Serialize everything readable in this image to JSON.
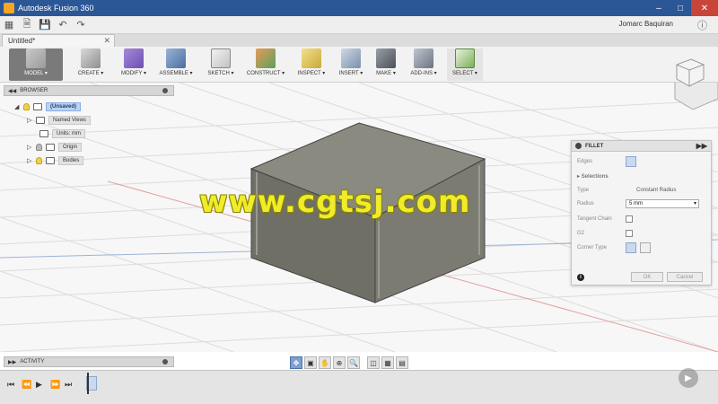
{
  "window": {
    "title": "Autodesk Fusion 360"
  },
  "quickbar": {
    "user": "Jomarc Baquiran"
  },
  "tab": {
    "name": "Untitled*"
  },
  "toolbar": {
    "items": [
      {
        "label": "MODEL ▾"
      },
      {
        "label": "CREATE ▾"
      },
      {
        "label": "MODIFY ▾"
      },
      {
        "label": "ASSEMBLE ▾"
      },
      {
        "label": "SKETCH ▾"
      },
      {
        "label": "CONSTRUCT ▾"
      },
      {
        "label": "INSPECT ▾"
      },
      {
        "label": "INSERT ▾"
      },
      {
        "label": "MAKE ▾"
      },
      {
        "label": "ADD-INS ▾"
      },
      {
        "label": "SELECT ▾"
      }
    ]
  },
  "browser": {
    "header": "BROWSER",
    "items": [
      {
        "label": "(Unsaved)"
      },
      {
        "label": "Named Views"
      },
      {
        "label": "Units: mm"
      },
      {
        "label": "Origin"
      },
      {
        "label": "Bodies"
      }
    ]
  },
  "fillet": {
    "title": "FILLET",
    "edges_label": "Edges",
    "selections_label": "Selections",
    "type_label": "Type",
    "type_value": "Constant Radius",
    "radius_label": "Radius",
    "radius_value": "5 mm",
    "tangent_chain_label": "Tangent Chain",
    "g2_label": "G2",
    "corner_type_label": "Corner Type",
    "ok_label": "OK",
    "cancel_label": "Cancel"
  },
  "activity": {
    "header": "ACTIVITY"
  },
  "watermark": {
    "text": "www.cgtsj.com"
  },
  "colors": {
    "titlebar": "#2b5797",
    "accent": "#7ea0cf",
    "body_fill": "#7b7b72"
  }
}
